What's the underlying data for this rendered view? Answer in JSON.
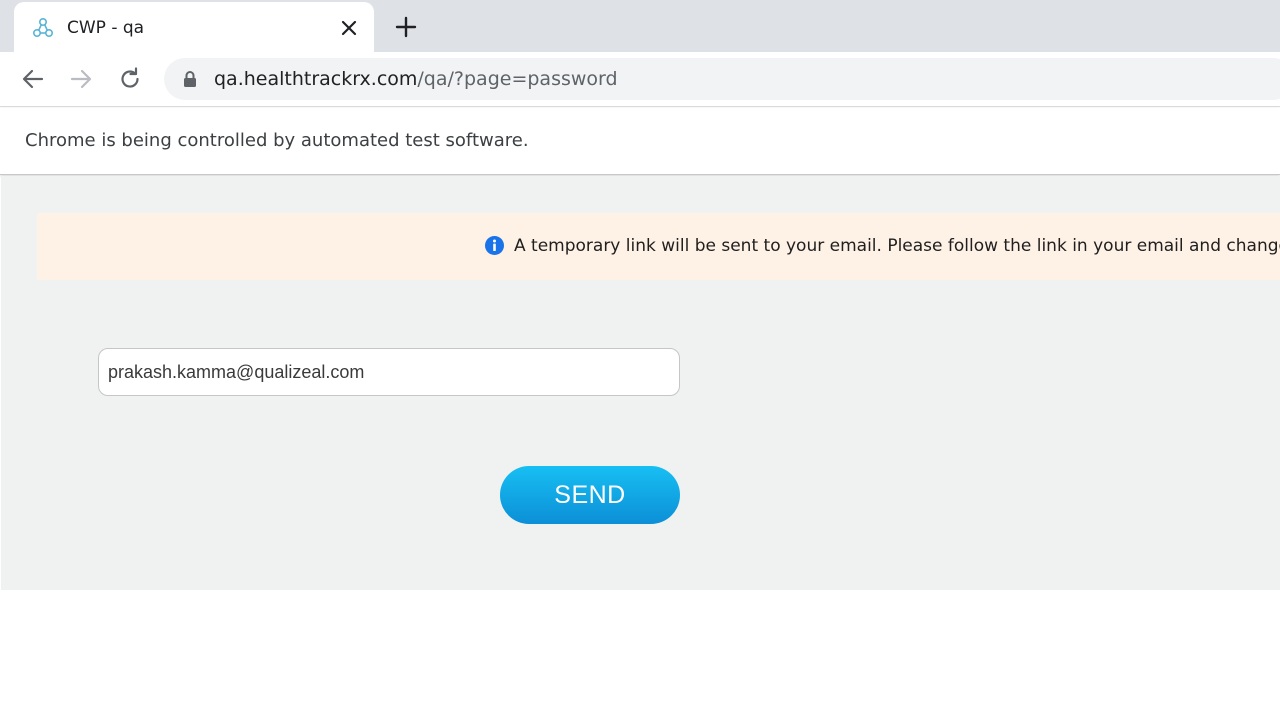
{
  "browser": {
    "tab": {
      "title": "CWP - qa",
      "favicon": "molecule-icon",
      "close_icon": "close-icon"
    },
    "new_tab_icon": "plus-icon",
    "nav": {
      "back_icon": "arrow-left-icon",
      "forward_icon": "arrow-right-icon",
      "reload_icon": "reload-icon"
    },
    "address": {
      "lock_icon": "lock-icon",
      "host": "qa.healthtrackrx.com",
      "path": "/qa/?page=password"
    },
    "infobar": "Chrome is being controlled by automated test software."
  },
  "page": {
    "alert": {
      "icon": "info-icon",
      "text": "A temporary link will be sent to your email. Please follow the link in your email and change the password."
    },
    "email_value": "prakash.kamma@qualizeal.com",
    "send_label": "SEND"
  },
  "colors": {
    "page_bg": "#eff2f1",
    "alert_bg": "#fef1e6",
    "info_icon": "#1a73e8",
    "button_top": "#17bff3",
    "button_bottom": "#0c8fd7"
  }
}
